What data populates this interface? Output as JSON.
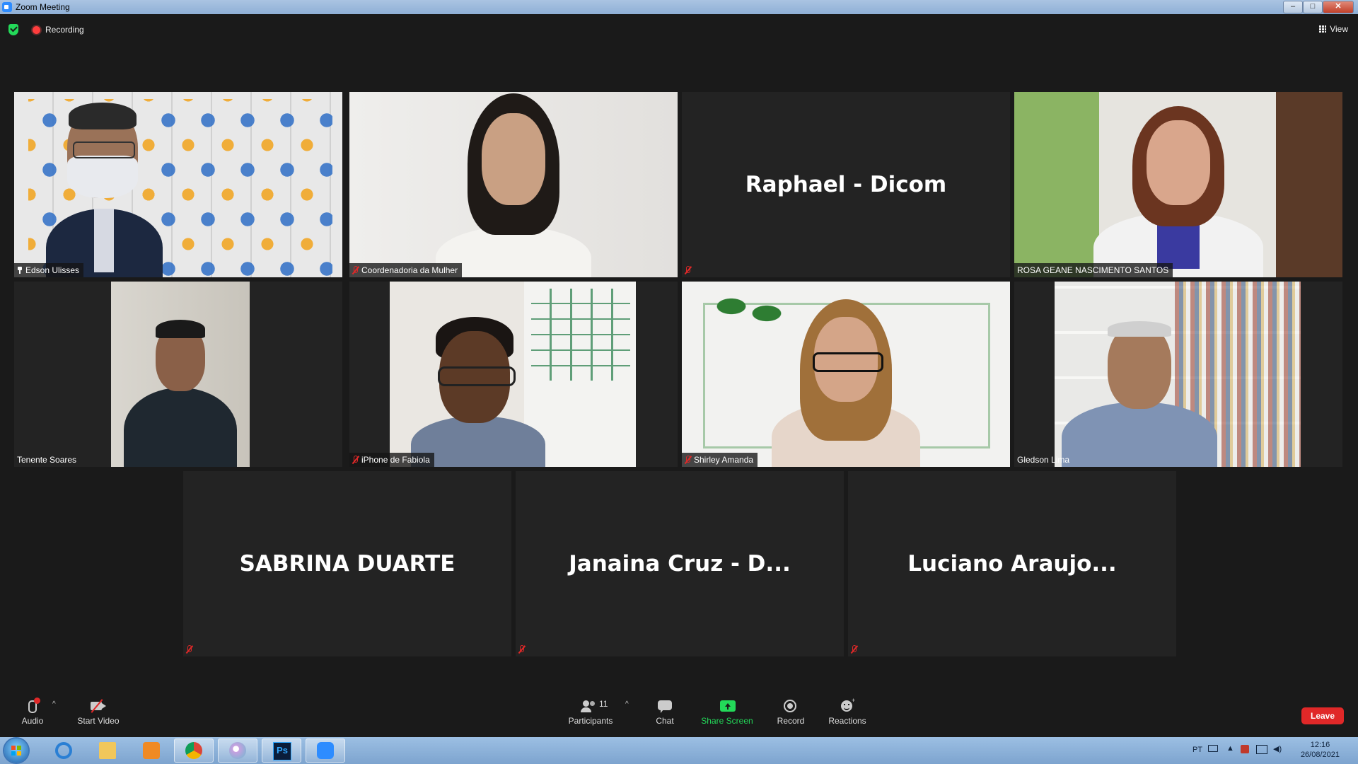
{
  "window": {
    "title": "Zoom Meeting",
    "min": "–",
    "max": "□",
    "close": "✕"
  },
  "topbar": {
    "recording_label": "Recording",
    "view_label": "View"
  },
  "tiles": [
    {
      "name": "Edson Ulisses",
      "active": true,
      "muted": false,
      "pinned": true
    },
    {
      "name": "Coordenadoria da Mulher",
      "muted": true
    },
    {
      "name": "Raphael - Dicom",
      "muted": true,
      "video": false
    },
    {
      "name": "ROSA GEANE NASCIMENTO SANTOS",
      "muted": false
    },
    {
      "name": "Tenente Soares",
      "muted": false
    },
    {
      "name": "iPhone de Fabiola",
      "muted": true
    },
    {
      "name": "Shirley Amanda",
      "muted": true
    },
    {
      "name": "Gledson Lima",
      "muted": false
    },
    {
      "name": "SABRINA DUARTE",
      "muted": true,
      "video": false
    },
    {
      "name": "Janaina Cruz - D...",
      "muted": true,
      "video": false
    },
    {
      "name": "Luciano  Araujo...",
      "muted": true,
      "video": false
    }
  ],
  "toolbar": {
    "audio": "Audio",
    "start_video": "Start Video",
    "participants": "Participants",
    "participants_count": "11",
    "chat": "Chat",
    "share_screen": "Share Screen",
    "record": "Record",
    "reactions": "Reactions",
    "leave": "Leave"
  },
  "taskbar": {
    "lang": "PT",
    "time": "12:16",
    "date": "26/08/2021"
  },
  "colors": {
    "active_speaker": "#c8e34a",
    "share_green": "#23d959",
    "leave_red": "#e02828",
    "muted_red": "#e02828"
  }
}
